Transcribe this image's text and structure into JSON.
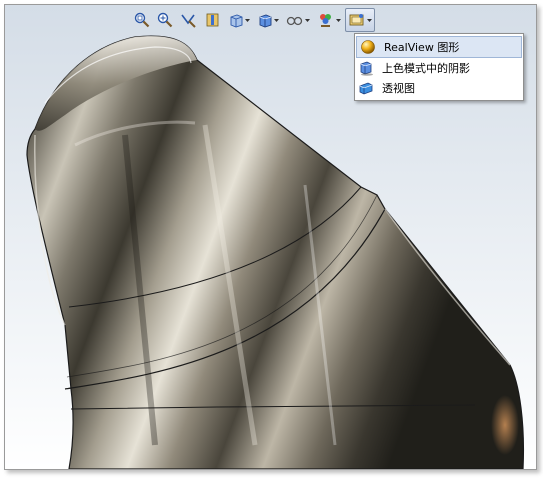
{
  "toolbar": {
    "icons": [
      "zoom-to-fit-icon",
      "zoom-to-area-icon",
      "previous-view-icon",
      "section-view-icon",
      "view-orientation-icon",
      "display-style-icon",
      "hide-show-items-icon",
      "edit-appearance-icon",
      "apply-scene-icon",
      "view-settings-icon"
    ]
  },
  "menu": {
    "items": [
      {
        "label": "RealView 图形",
        "icon": "realview-sphere-icon",
        "selected": true
      },
      {
        "label": "上色模式中的阴影",
        "icon": "shadows-in-shaded-mode-icon",
        "selected": false
      },
      {
        "label": "透视图",
        "icon": "perspective-icon",
        "selected": false
      }
    ]
  },
  "colors": {
    "background_top": "#d4dde7",
    "background_bottom": "#ffffff",
    "metal_dark": "#35322a",
    "metal_mid": "#8a8374",
    "metal_light": "#e8e4d8",
    "edge": "#1b1b1b",
    "menu_highlight": "#dce6f4"
  }
}
